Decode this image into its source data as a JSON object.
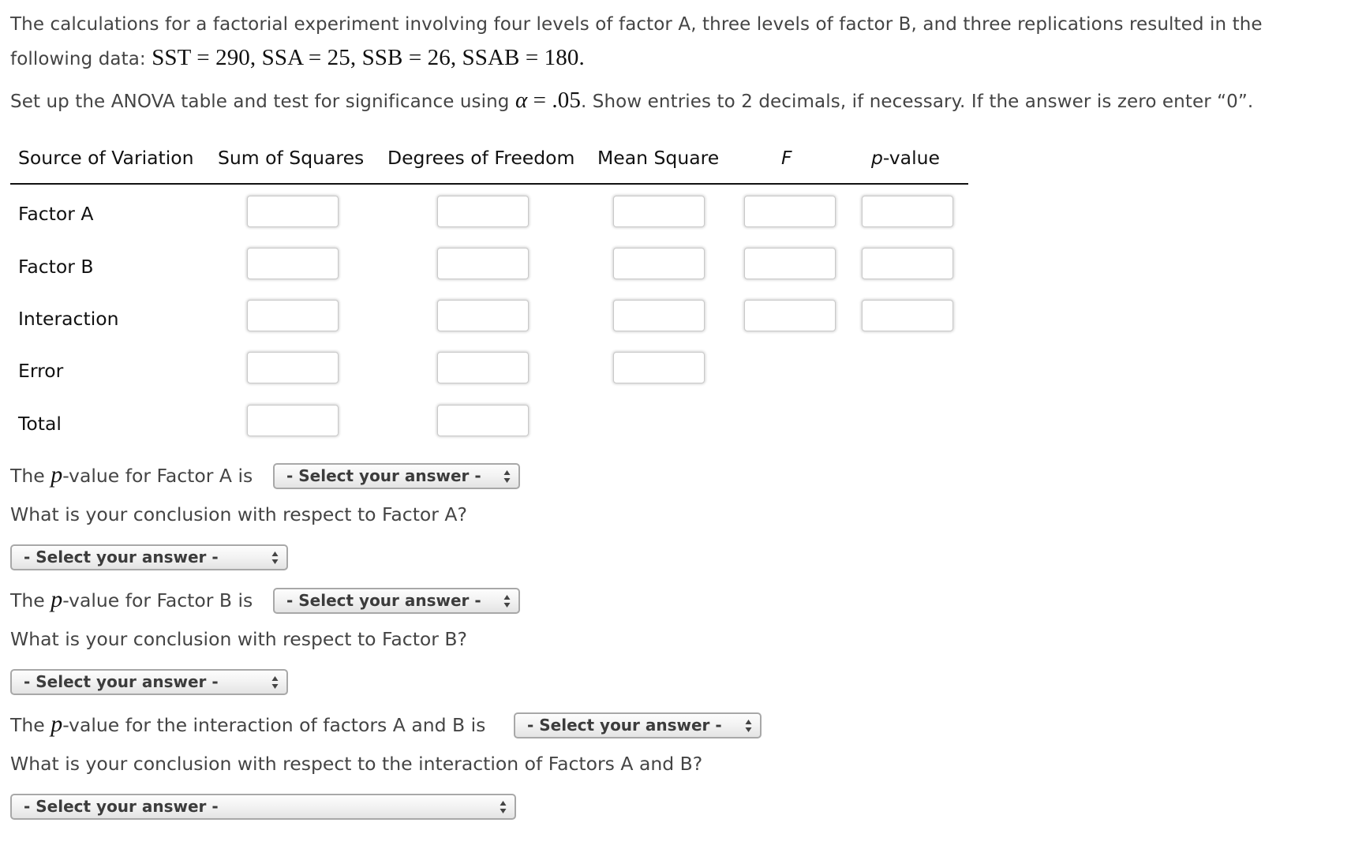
{
  "problem": {
    "intro_text": "The calculations for a factorial experiment involving four levels of factor A, three levels of factor B, and three replications resulted in the following data:",
    "given_values": [
      {
        "name": "SST",
        "value": "290"
      },
      {
        "name": "SSA",
        "value": "25"
      },
      {
        "name": "SSB",
        "value": "26"
      },
      {
        "name": "SSAB",
        "value": "180"
      }
    ],
    "instruction_prefix": "Set up the ANOVA table and test for significance using",
    "alpha_symbol": "α",
    "alpha_value": ".05",
    "instruction_suffix": ". Show entries to 2 decimals, if necessary. If the answer is zero enter “0”."
  },
  "anova_table": {
    "columns": [
      {
        "label": "Source of Variation"
      },
      {
        "label": "Sum of Squares"
      },
      {
        "label": "Degrees of Freedom"
      },
      {
        "label": "Mean Square"
      },
      {
        "label": "F"
      },
      {
        "label_italic": "p",
        "label_rest": "-value"
      }
    ],
    "rows": [
      {
        "source": "Factor A",
        "sum_of_squares": "",
        "degrees_of_freedom": "",
        "mean_square": "",
        "f": "",
        "p_value": ""
      },
      {
        "source": "Factor B",
        "sum_of_squares": "",
        "degrees_of_freedom": "",
        "mean_square": "",
        "f": "",
        "p_value": ""
      },
      {
        "source": "Interaction",
        "sum_of_squares": "",
        "degrees_of_freedom": "",
        "mean_square": "",
        "f": "",
        "p_value": ""
      },
      {
        "source": "Error",
        "sum_of_squares": "",
        "degrees_of_freedom": "",
        "mean_square": ""
      },
      {
        "source": "Total",
        "sum_of_squares": "",
        "degrees_of_freedom": ""
      }
    ]
  },
  "questions": {
    "p_symbol": "p",
    "factor_a_pvalue": {
      "prefix": "The",
      "suffix": "-value for Factor A is",
      "selected": "- Select your answer -"
    },
    "factor_a_conclusion": {
      "text": "What is your conclusion with respect to Factor A?",
      "selected": "- Select your answer -"
    },
    "factor_b_pvalue": {
      "prefix": "The",
      "suffix": "-value for Factor B is",
      "selected": "- Select your answer -"
    },
    "factor_b_conclusion": {
      "text": "What is your conclusion with respect to Factor B?",
      "selected": "- Select your answer -"
    },
    "interaction_pvalue": {
      "prefix": "The",
      "suffix": "-value for the interaction of factors A and B is",
      "selected": "- Select your answer -"
    },
    "interaction_conclusion": {
      "text": "What is your conclusion with respect to the interaction of Factors A and B?",
      "selected": "- Select your answer -"
    }
  }
}
